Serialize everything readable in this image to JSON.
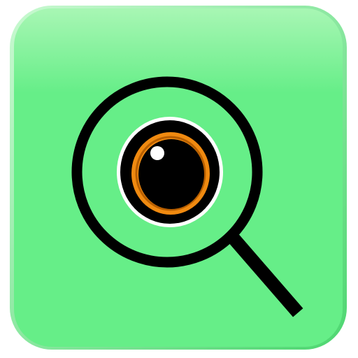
{
  "app_icon": {
    "name": "magnifier-eye-app-icon",
    "colors": {
      "tile_fill": "#66ee88",
      "tile_highlight": "#a8f6b4",
      "tile_edge_light": "#c9f9d1",
      "tile_edge_dark": "#4dd670",
      "lens_ring": "#000000",
      "handle": "#000000",
      "eye_outline_white": "#ffffff",
      "eye_outline_black": "#000000",
      "iris": "#f08a10",
      "iris_dark": "#b85f00",
      "pupil": "#000000",
      "catchlight": "#ffffff"
    },
    "icons": [
      "magnifying-glass-icon",
      "eye-icon"
    ]
  }
}
